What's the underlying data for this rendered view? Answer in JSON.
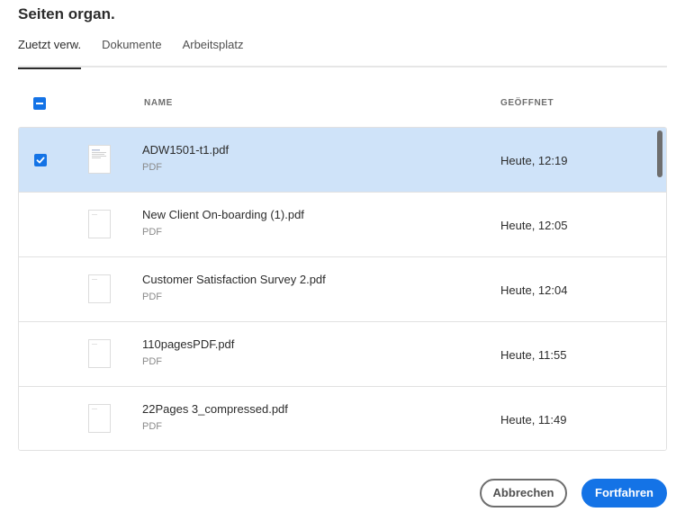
{
  "dialog": {
    "title": "Seiten organ."
  },
  "tabs": [
    {
      "label": "Zuetzt verw.",
      "active": true
    },
    {
      "label": "Dokumente",
      "active": false
    },
    {
      "label": "Arbeitsplatz",
      "active": false
    }
  ],
  "table": {
    "columns": {
      "name": "NAME",
      "opened": "GEÖFFNET"
    },
    "rows": [
      {
        "name": "ADW1501-t1.pdf",
        "type": "PDF",
        "opened": "Heute, 12:19",
        "selected": true
      },
      {
        "name": "New Client On-boarding (1).pdf",
        "type": "PDF",
        "opened": "Heute, 12:05",
        "selected": false
      },
      {
        "name": "Customer Satisfaction Survey 2.pdf",
        "type": "PDF",
        "opened": "Heute, 12:04",
        "selected": false
      },
      {
        "name": "110pagesPDF.pdf",
        "type": "PDF",
        "opened": "Heute, 11:55",
        "selected": false
      },
      {
        "name": "22Pages 3_compressed.pdf",
        "type": "PDF",
        "opened": "Heute, 11:49",
        "selected": false
      }
    ]
  },
  "buttons": {
    "cancel": "Abbrechen",
    "continue": "Fortfahren"
  },
  "colors": {
    "accent": "#1473e6",
    "selected_row": "#cfe3f9"
  }
}
